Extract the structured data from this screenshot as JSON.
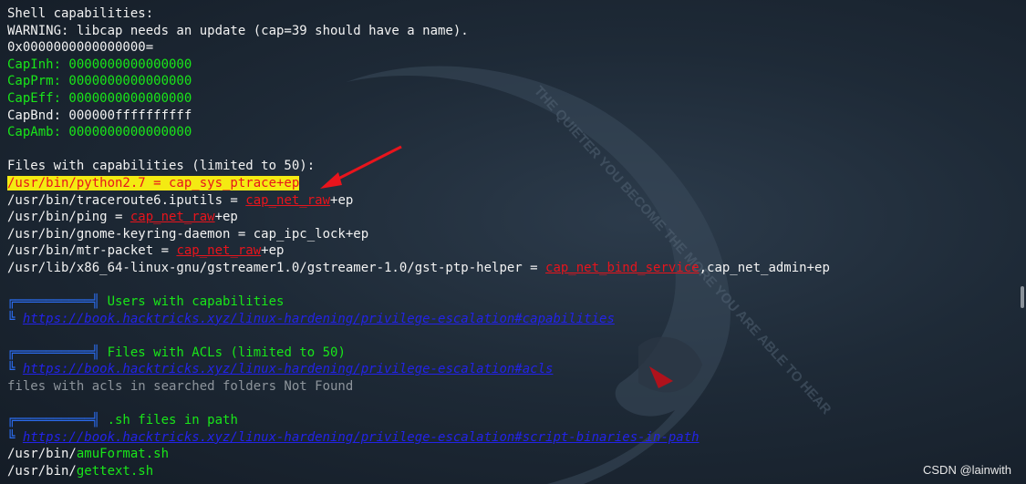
{
  "lines": [
    {
      "segments": [
        {
          "t": "Shell capabilities:",
          "c": "w"
        }
      ]
    },
    {
      "segments": [
        {
          "t": "WARNING: libcap needs an update (cap=39 should have a name).",
          "c": "w"
        }
      ]
    },
    {
      "segments": [
        {
          "t": "0x0000000000000000=",
          "c": "w"
        }
      ]
    },
    {
      "segments": [
        {
          "t": "CapInh: 0000000000000000",
          "c": "g"
        }
      ]
    },
    {
      "segments": [
        {
          "t": "CapPrm: 0000000000000000",
          "c": "g"
        }
      ]
    },
    {
      "segments": [
        {
          "t": "CapEff: 0000000000000000",
          "c": "g"
        }
      ]
    },
    {
      "segments": [
        {
          "t": "CapBnd: 000000ffffffffff",
          "c": "w"
        }
      ]
    },
    {
      "segments": [
        {
          "t": "CapAmb: 0000000000000000",
          "c": "g"
        }
      ]
    },
    {
      "segments": [
        {
          "t": "",
          "c": "w"
        }
      ]
    },
    {
      "segments": [
        {
          "t": "Files with capabilities (limited to 50):",
          "c": "w"
        }
      ]
    },
    {
      "segments": [
        {
          "t": "/usr/bin/python2.7 = cap_sys_ptrace+ep",
          "c": "hl"
        }
      ]
    },
    {
      "segments": [
        {
          "t": "/usr/bin/traceroute6.iputils = ",
          "c": "w"
        },
        {
          "t": "cap_net_raw",
          "c": "r"
        },
        {
          "t": "+ep",
          "c": "w"
        }
      ]
    },
    {
      "segments": [
        {
          "t": "/usr/bin/ping = ",
          "c": "w"
        },
        {
          "t": "cap_net_raw",
          "c": "r"
        },
        {
          "t": "+ep",
          "c": "w"
        }
      ]
    },
    {
      "segments": [
        {
          "t": "/usr/bin/gnome-keyring-daemon = cap_ipc_lock+ep",
          "c": "w"
        }
      ]
    },
    {
      "segments": [
        {
          "t": "/usr/bin/mtr-packet = ",
          "c": "w"
        },
        {
          "t": "cap_net_raw",
          "c": "r"
        },
        {
          "t": "+ep",
          "c": "w"
        }
      ]
    },
    {
      "segments": [
        {
          "t": "/usr/lib/x86_64-linux-gnu/gstreamer1.0/gstreamer-1.0/gst-ptp-helper = ",
          "c": "w"
        },
        {
          "t": "cap_net_bind_service",
          "c": "r"
        },
        {
          "t": ",cap_net_admin+ep",
          "c": "w"
        }
      ]
    },
    {
      "segments": [
        {
          "t": "",
          "c": "w"
        }
      ]
    },
    {
      "segments": [
        {
          "t": "╔══════════╣ ",
          "c": "box"
        },
        {
          "t": "Users with capabilities",
          "c": "g"
        }
      ]
    },
    {
      "segments": [
        {
          "t": "╚ ",
          "c": "box"
        },
        {
          "t": "https://book.hacktricks.xyz/linux-hardening/privilege-escalation#capabilities",
          "c": "blue"
        }
      ]
    },
    {
      "segments": [
        {
          "t": "",
          "c": "w"
        }
      ]
    },
    {
      "segments": [
        {
          "t": "╔══════════╣ ",
          "c": "box"
        },
        {
          "t": "Files with ACLs (limited to 50)",
          "c": "g"
        }
      ]
    },
    {
      "segments": [
        {
          "t": "╚ ",
          "c": "box"
        },
        {
          "t": "https://book.hacktricks.xyz/linux-hardening/privilege-escalation#acls",
          "c": "blue"
        }
      ]
    },
    {
      "segments": [
        {
          "t": "files with acls in searched folders Not Found",
          "c": "gray"
        }
      ]
    },
    {
      "segments": [
        {
          "t": "",
          "c": "w"
        }
      ]
    },
    {
      "segments": [
        {
          "t": "╔══════════╣ ",
          "c": "box"
        },
        {
          "t": ".sh files in path",
          "c": "g"
        }
      ]
    },
    {
      "segments": [
        {
          "t": "╚ ",
          "c": "box"
        },
        {
          "t": "https://book.hacktricks.xyz/linux-hardening/privilege-escalation#script-binaries-in-path",
          "c": "blue"
        }
      ]
    },
    {
      "segments": [
        {
          "t": "/usr/bin/",
          "c": "w"
        },
        {
          "t": "amuFormat.sh",
          "c": "g"
        }
      ]
    },
    {
      "segments": [
        {
          "t": "/usr/bin/",
          "c": "w"
        },
        {
          "t": "gettext.sh",
          "c": "g"
        }
      ]
    }
  ],
  "watermark": "CSDN @lainwith",
  "background_logo_text": "THE QUIETER YOU BECOME THE MORE YOU ARE ABLE TO HEAR",
  "colors": {
    "green": "#19e619",
    "red": "#e8141c",
    "highlight": "#f4ea12",
    "link": "#2323e8",
    "arrow": "#e8141c"
  }
}
